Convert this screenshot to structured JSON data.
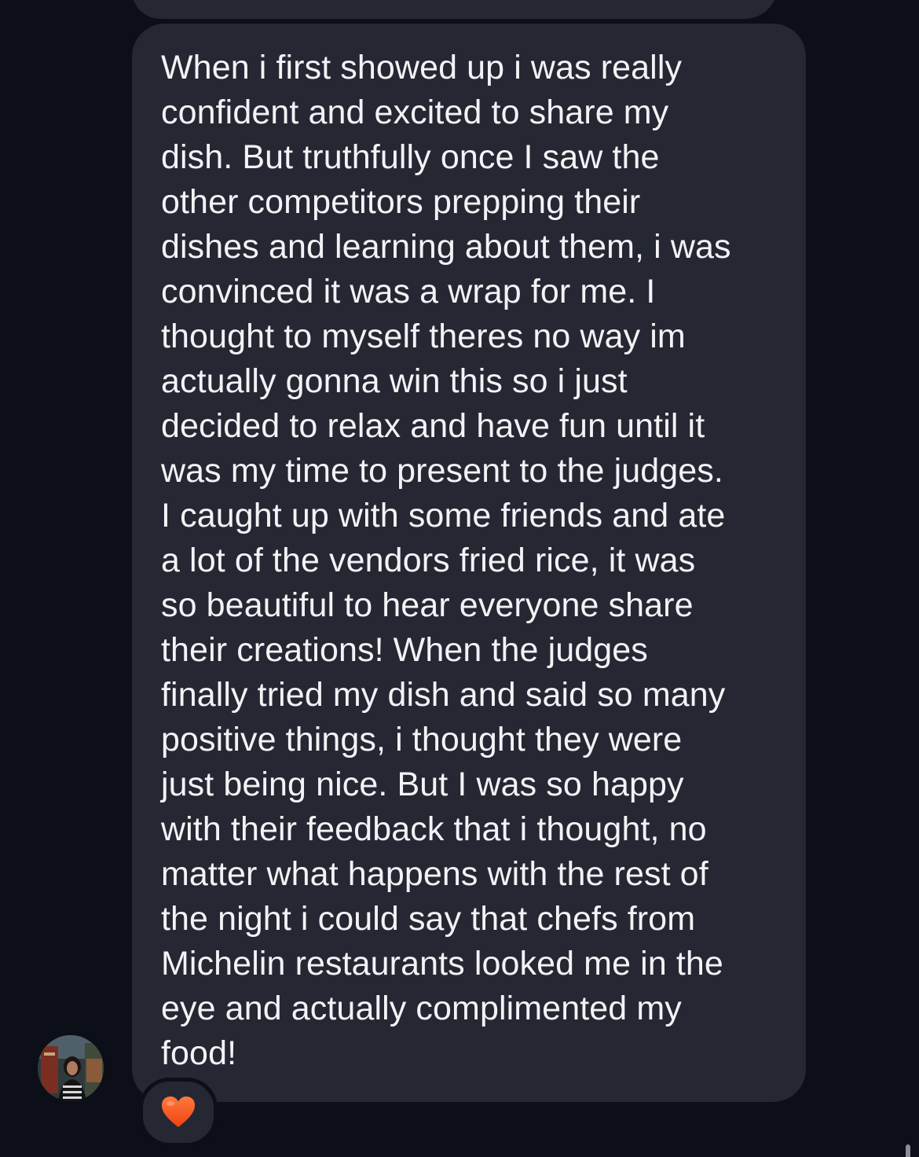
{
  "conversation": {
    "message": {
      "lines": [
        "When i first showed up i was really",
        "confident and excited to share my",
        "dish. But truthfully once I saw the",
        "other competitors prepping their",
        "dishes and learning about them, i was",
        "convinced it was a wrap for me. I",
        "thought to myself theres no way im",
        "actually gonna win this so i just",
        "decided to relax and have fun until it",
        "was my time to present to the judges.",
        "I caught up with some friends and ate",
        "a lot of the vendors fried rice, it was",
        "so beautiful to hear everyone share",
        "their creations! When the judges",
        "finally tried my dish and said so many",
        "positive things, i thought they were",
        "just being nice. But I was so happy",
        "with their feedback that i thought, no",
        "matter what happens with the rest of",
        "the night i could say that chefs from",
        "Michelin restaurants looked me in the",
        "eye and actually complimented my",
        "food!"
      ],
      "reaction": "❤️",
      "reaction_icon": "orange-heart-icon",
      "sender_avatar_icon": "avatar-photo"
    }
  },
  "colors": {
    "background": "#0c0f18",
    "bubble": "#252833",
    "text": "#f2f3f5",
    "heart": "#ff5a1f"
  }
}
